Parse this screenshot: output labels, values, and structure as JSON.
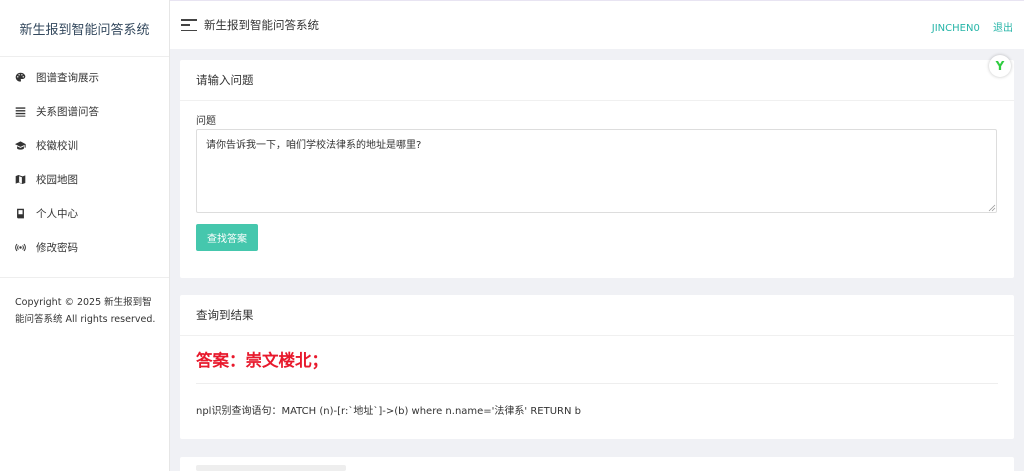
{
  "sidebar": {
    "brand": "新生报到智能问答系统",
    "items": [
      {
        "label": "图谱查询展示",
        "icon": "palette-icon"
      },
      {
        "label": "关系图谱问答",
        "icon": "list-icon"
      },
      {
        "label": "校徽校训",
        "icon": "graduation-cap-icon"
      },
      {
        "label": "校园地图",
        "icon": "map-icon"
      },
      {
        "label": "个人中心",
        "icon": "book-icon"
      },
      {
        "label": "修改密码",
        "icon": "broadcast-icon"
      }
    ],
    "copyright": "Copyright © 2025 新生报到智能问答系统 All rights reserved."
  },
  "topbar": {
    "title": "新生报到智能问答系统",
    "username": "JINCHEN0",
    "logout": "退出"
  },
  "question_card": {
    "header": "请输入问题",
    "field_label": "问题",
    "question_value": "请你告诉我一下，咱们学校法律系的地址是哪里?",
    "submit_label": "查找答案",
    "badge_glyph": "Y"
  },
  "result_card": {
    "header": "查询到结果",
    "answer": "答案：崇文楼北；",
    "query_text": "npl识别查询语句：MATCH (n)-[r:`地址`]->(b) where n.name='法律系' RETURN b"
  },
  "colors": {
    "accent": "#45c7ad",
    "answer_red": "#e8192c",
    "link_teal": "#26b5a8"
  }
}
